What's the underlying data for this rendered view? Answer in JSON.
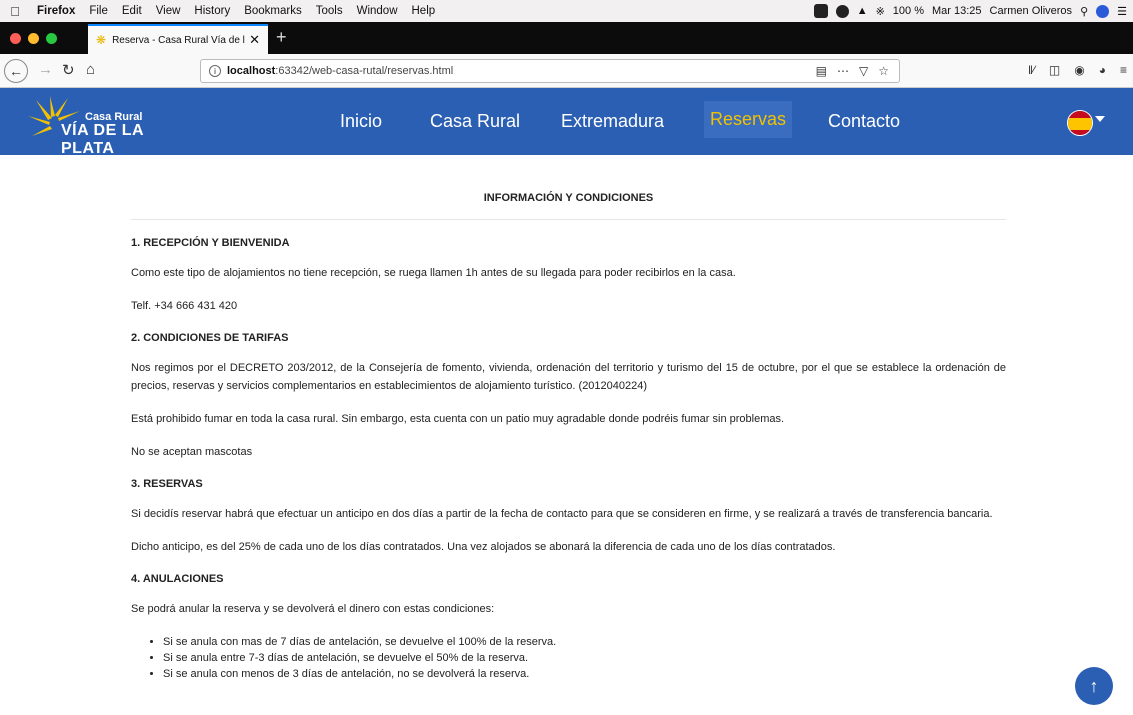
{
  "macbar": {
    "app": "Firefox",
    "menus": [
      "File",
      "Edit",
      "View",
      "History",
      "Bookmarks",
      "Tools",
      "Window",
      "Help"
    ],
    "battery": "100 %",
    "clock": "Mar 13:25",
    "user": "Carmen Oliveros"
  },
  "browser": {
    "tab_title": "Reserva - Casa Rural Vía de la P",
    "url_host": "localhost",
    "url_rest": ":63342/web-casa-rutal/reservas.html"
  },
  "site": {
    "logo_line1": "Casa Rural",
    "logo_line2": "VÍA DE LA PLATA",
    "nav": {
      "inicio": "Inicio",
      "casa": "Casa Rural",
      "extremadura": "Extremadura",
      "reservas": "Reservas",
      "contacto": "Contacto"
    }
  },
  "content": {
    "heading": "INFORMACIÓN Y CONDICIONES",
    "s1_title": "1. RECEPCIÓN Y BIENVENIDA",
    "s1_p1": "Como este tipo de alojamientos no tiene recepción, se ruega llamen 1h antes de su llegada para poder recibirlos en la casa.",
    "s1_p2": "Telf. +34 666 431 420",
    "s2_title": "2. CONDICIONES DE TARIFAS",
    "s2_p1": "Nos regimos por el DECRETO 203/2012, de la Consejería de fomento, vivienda, ordenación del territorio y turismo del 15 de octubre, por el que se establece la ordenación de precios, reservas y servicios complementarios en establecimientos de alojamiento turístico. (2012040224)",
    "s2_p2": "Está prohibido fumar en toda la casa rural. Sin embargo, esta cuenta con un patio muy agradable donde podréis fumar sin problemas.",
    "s2_p3": "No se aceptan mascotas",
    "s3_title": "3. RESERVAS",
    "s3_p1": "Si decidís reservar habrá que efectuar un anticipo en dos días a partir de la fecha de contacto para que se consideren en firme, y se realizará a través de transferencia bancaria.",
    "s3_p2": "Dicho anticipo, es del 25% de cada uno de los días contratados. Una vez alojados se abonará la diferencia de cada uno de los días contratados.",
    "s4_title": "4. ANULACIONES",
    "s4_p1": "Se podrá anular la reserva y se devolverá el dinero con estas condiciones:",
    "s4_items": [
      "Si se anula con mas de 7 días de antelación, se devuelve el 100% de la reserva.",
      "Si se anula entre 7-3 días de antelación, se devuelve el 50% de la reserva.",
      "Si se anula con menos de 3 días de antelación, no se devolverá la reserva."
    ]
  },
  "colors": {
    "nav_bg": "#2b5fb3",
    "active_link": "#f2c200"
  }
}
